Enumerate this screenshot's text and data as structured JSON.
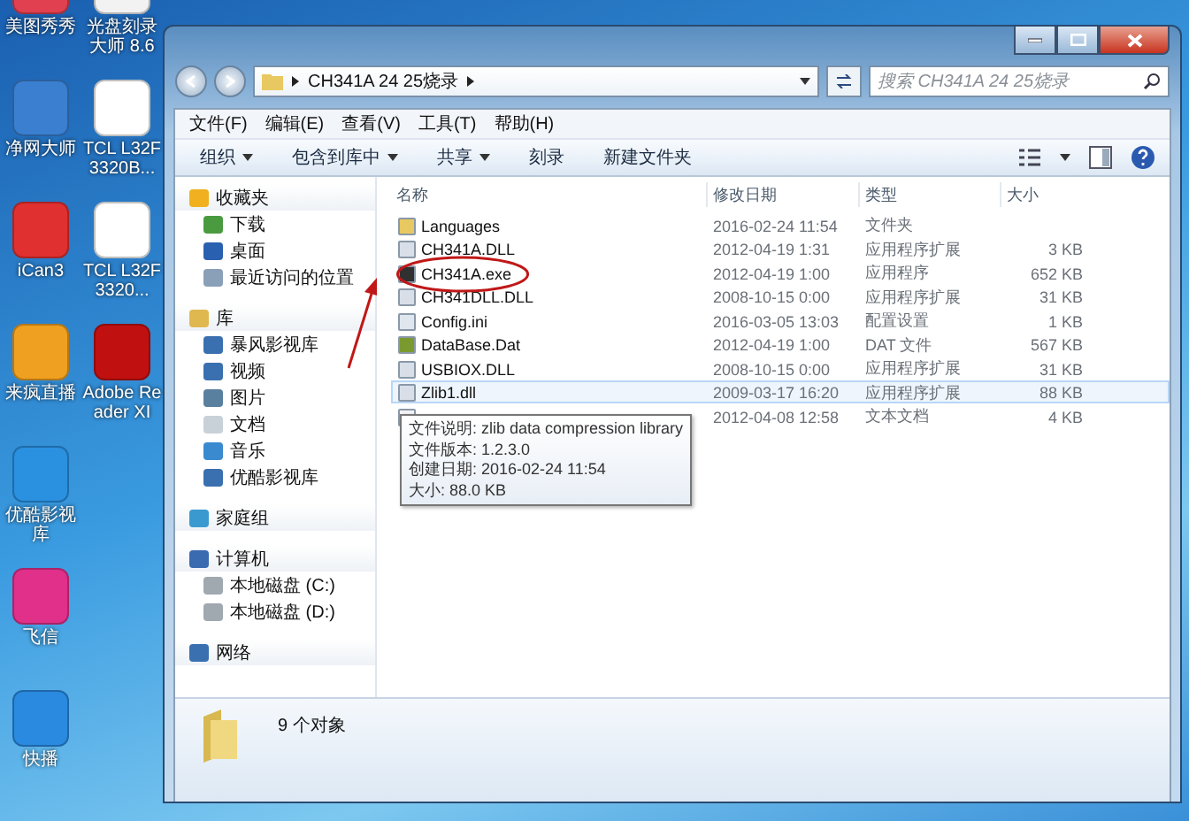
{
  "desktop": {
    "columns": [
      [
        {
          "label": "美图秀秀",
          "kind": "photo-app"
        },
        {
          "label": "净网大师",
          "kind": "shield"
        },
        {
          "label": "iCan3",
          "kind": "c-logo"
        },
        {
          "label": "来疯直播",
          "kind": "live"
        },
        {
          "label": "优酷影视库",
          "kind": "video"
        },
        {
          "label": "飞信",
          "kind": "chat"
        },
        {
          "label": "快播",
          "kind": "play"
        }
      ],
      [
        {
          "label": "光盘刻录大师 8.6",
          "kind": "disc"
        },
        {
          "label": "TCL L32F3320B...",
          "kind": "document"
        },
        {
          "label": "TCL L32F3320...",
          "kind": "document"
        },
        {
          "label": "Adobe Reader XI",
          "kind": "pdf"
        }
      ]
    ]
  },
  "window": {
    "address": {
      "path": "CH341A 24 25烧录"
    },
    "search": {
      "placeholder": "搜索 CH341A 24 25烧录"
    },
    "menu": [
      "文件(F)",
      "编辑(E)",
      "查看(V)",
      "工具(T)",
      "帮助(H)"
    ],
    "toolbar": [
      {
        "label": "组织",
        "has_menu": true
      },
      {
        "label": "包含到库中",
        "has_menu": true
      },
      {
        "label": "共享",
        "has_menu": true
      },
      {
        "label": "刻录",
        "has_menu": false
      },
      {
        "label": "新建文件夹",
        "has_menu": false
      }
    ],
    "sidebar": [
      {
        "label": "收藏夹",
        "kind": "star",
        "children": [
          {
            "label": "下载",
            "kind": "download"
          },
          {
            "label": "桌面",
            "kind": "desktop"
          },
          {
            "label": "最近访问的位置",
            "kind": "recent"
          }
        ]
      },
      {
        "label": "库",
        "kind": "library",
        "children": [
          {
            "label": "暴风影视库",
            "kind": "film"
          },
          {
            "label": "视频",
            "kind": "film"
          },
          {
            "label": "图片",
            "kind": "picture"
          },
          {
            "label": "文档",
            "kind": "doc"
          },
          {
            "label": "音乐",
            "kind": "music"
          },
          {
            "label": "优酷影视库",
            "kind": "film"
          }
        ]
      },
      {
        "label": "家庭组",
        "kind": "homegroup"
      },
      {
        "label": "计算机",
        "kind": "computer",
        "children": [
          {
            "label": "本地磁盘 (C:)",
            "kind": "drive"
          },
          {
            "label": "本地磁盘 (D:)",
            "kind": "drive"
          }
        ]
      },
      {
        "label": "网络",
        "kind": "network"
      }
    ],
    "columns": [
      "名称",
      "修改日期",
      "类型",
      "大小"
    ],
    "files": [
      {
        "name": "Languages",
        "date": "2016-02-24 11:54",
        "type": "文件夹",
        "kind": "folder",
        "hovered": false
      },
      {
        "name": "CH341A.DLL",
        "date": "2012-04-19 1:31",
        "type": "应用程序扩展",
        "size": "3 KB",
        "kind": "dll",
        "hovered": false
      },
      {
        "name": "CH341A.exe",
        "date": "2012-04-19 1:00",
        "type": "应用程序",
        "size": "652 KB",
        "kind": "exe",
        "hovered": false,
        "circled": true
      },
      {
        "name": "CH341DLL.DLL",
        "date": "2008-10-15 0:00",
        "type": "应用程序扩展",
        "size": "31 KB",
        "kind": "dll",
        "hovered": false
      },
      {
        "name": "Config.ini",
        "date": "2016-03-05 13:03",
        "type": "配置设置",
        "size": "1 KB",
        "kind": "ini",
        "hovered": false
      },
      {
        "name": "DataBase.Dat",
        "date": "2012-04-19 1:00",
        "type": "DAT 文件",
        "size": "567 KB",
        "kind": "dat",
        "hovered": false
      },
      {
        "name": "USBIOX.DLL",
        "date": "2008-10-15 0:00",
        "type": "应用程序扩展",
        "size": "31 KB",
        "kind": "dll",
        "hovered": false
      },
      {
        "name": "Zlib1.dll",
        "date": "2009-03-17 16:20",
        "type": "应用程序扩展",
        "size": "88 KB",
        "kind": "dll",
        "hovered": true
      },
      {
        "date": "2012-04-08 12:58",
        "type": "文本文档",
        "size": "4 KB",
        "kind": "txt",
        "hovered": false
      }
    ],
    "tooltip": [
      "文件说明: zlib data compression library",
      "文件版本: 1.2.3.0",
      "创建日期: 2016-02-24 11:54",
      "大小: 88.0 KB"
    ],
    "status": {
      "count": "9 个对象"
    }
  }
}
